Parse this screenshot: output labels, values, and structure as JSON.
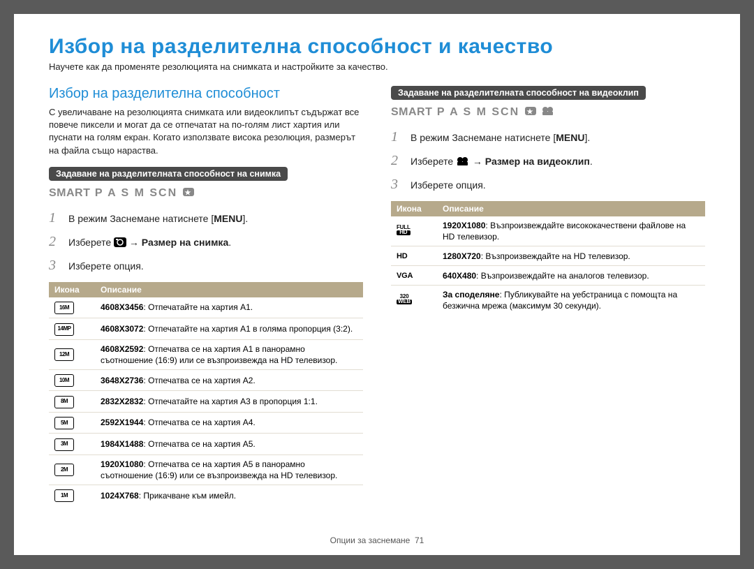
{
  "page_title": "Избор на разделителна способност и качество",
  "intro": "Научете как да променяте резолюцията на снимката и настройките за качество.",
  "left": {
    "section_title": "Избор на разделителна способност",
    "section_desc": "С увеличаване на резолюцията снимката или видеоклипът съдържат все повече пиксели и могат да се отпечатат на по-голям лист хартия или пуснати на голям екран. Когато използвате висока резолюция, размерът на файла също нараства.",
    "bar_label": "Задаване на разделителната способност на снимка",
    "mode_line_prefix": "SMART",
    "mode_line_letters": "P A S M SCN",
    "steps": {
      "s1_a": "В режим Заснемане натиснете [",
      "s1_menu": "MENU",
      "s1_b": "].",
      "s2_a": "Изберете ",
      "s2_b": " → Размер на снимка",
      "s2_c": ".",
      "s3": "Изберете опция."
    },
    "table": {
      "h_icon": "Икона",
      "h_desc": "Описание",
      "rows": [
        {
          "icon": "16M",
          "bold": "4608X3456",
          "text": ": Отпечатайте на хартия A1."
        },
        {
          "icon": "14MP",
          "bold": "4608X3072",
          "text": ": Отпечатайте на хартия A1 в голяма пропорция (3:2)."
        },
        {
          "icon": "12M",
          "bold": "4608X2592",
          "text": ": Отпечатва се на хартия A1 в панорамно съотношение (16:9) или се възпроизвежда на HD телевизор."
        },
        {
          "icon": "10M",
          "bold": "3648X2736",
          "text": ": Отпечатва се на хартия A2."
        },
        {
          "icon": "8M",
          "bold": "2832X2832",
          "text": ": Отпечатайте на хартия A3 в пропорция 1:1."
        },
        {
          "icon": "5M",
          "bold": "2592X1944",
          "text": ": Отпечатва се на хартия A4."
        },
        {
          "icon": "3M",
          "bold": "1984X1488",
          "text": ": Отпечатва се на хартия A5."
        },
        {
          "icon": "2M",
          "bold": "1920X1080",
          "text": ": Отпечатва се на хартия A5 в панорамно съотношение (16:9) или се възпроизвежда на HD телевизор."
        },
        {
          "icon": "1M",
          "bold": "1024X768",
          "text": ": Прикачване към имейл."
        }
      ]
    }
  },
  "right": {
    "bar_label": "Задаване на разделителната способност на видеоклип",
    "mode_line_prefix": "SMART",
    "mode_line_letters": "P A S M SCN",
    "steps": {
      "s1_a": "В режим Заснемане натиснете [",
      "s1_menu": "MENU",
      "s1_b": "].",
      "s2_a": "Изберете ",
      "s2_b": " → Размер на видеоклип",
      "s2_c": ".",
      "s3": "Изберете опция."
    },
    "table": {
      "h_icon": "Икона",
      "h_desc": "Описание",
      "rows": [
        {
          "icon_type": "fullhd",
          "icon_top": "FULL",
          "icon_bot": "HD",
          "bold": "1920X1080",
          "text": ": Възпроизвеждайте висококачествени файлове на HD телевизор."
        },
        {
          "icon_type": "hd",
          "icon_label": "HD",
          "bold": "1280X720",
          "text": ": Възпроизвеждайте на HD телевизор."
        },
        {
          "icon_type": "vga",
          "icon_label": "VGA",
          "bold": "640X480",
          "text": ": Възпроизвеждайте на аналогов телевизор."
        },
        {
          "icon_type": "web",
          "icon_top": "320",
          "icon_bot": "WEB",
          "bold": "За споделяне",
          "text": ": Публикувайте на уебстраница с помощта на безжична мрежа (максимум 30 секунди)."
        }
      ]
    }
  },
  "footer_label": "Опции за заснемане",
  "footer_page": "71"
}
